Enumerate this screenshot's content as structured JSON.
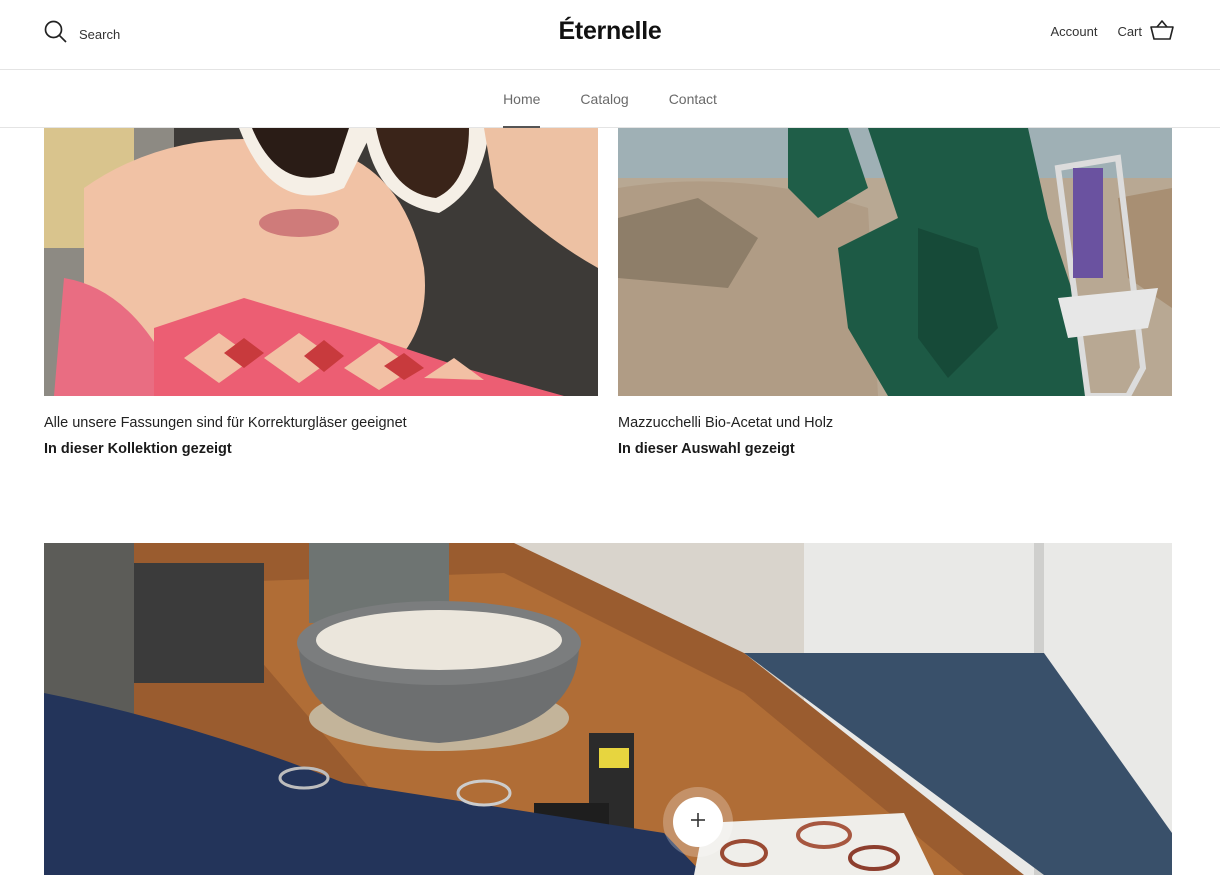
{
  "header": {
    "search_label": "Search",
    "logo": "Éternelle",
    "account_label": "Account",
    "cart_label": "Cart"
  },
  "nav": {
    "items": [
      {
        "label": "Home",
        "active": true
      },
      {
        "label": "Catalog",
        "active": false
      },
      {
        "label": "Contact",
        "active": false
      }
    ]
  },
  "collections": [
    {
      "title": "Alle unsere Fassungen sind für Korrekturgläser geeignet",
      "link": "In dieser Kollektion gezeigt",
      "image": "woman-white-sunglasses"
    },
    {
      "title": "Mazzucchelli Bio-Acetat und Holz",
      "link": "In dieser Auswahl gezeigt",
      "image": "person-green-suit-on-rocks"
    }
  ],
  "banner": {
    "image": "table-with-eyeglasses-and-bowl",
    "hotspot_icon": "plus-icon"
  }
}
